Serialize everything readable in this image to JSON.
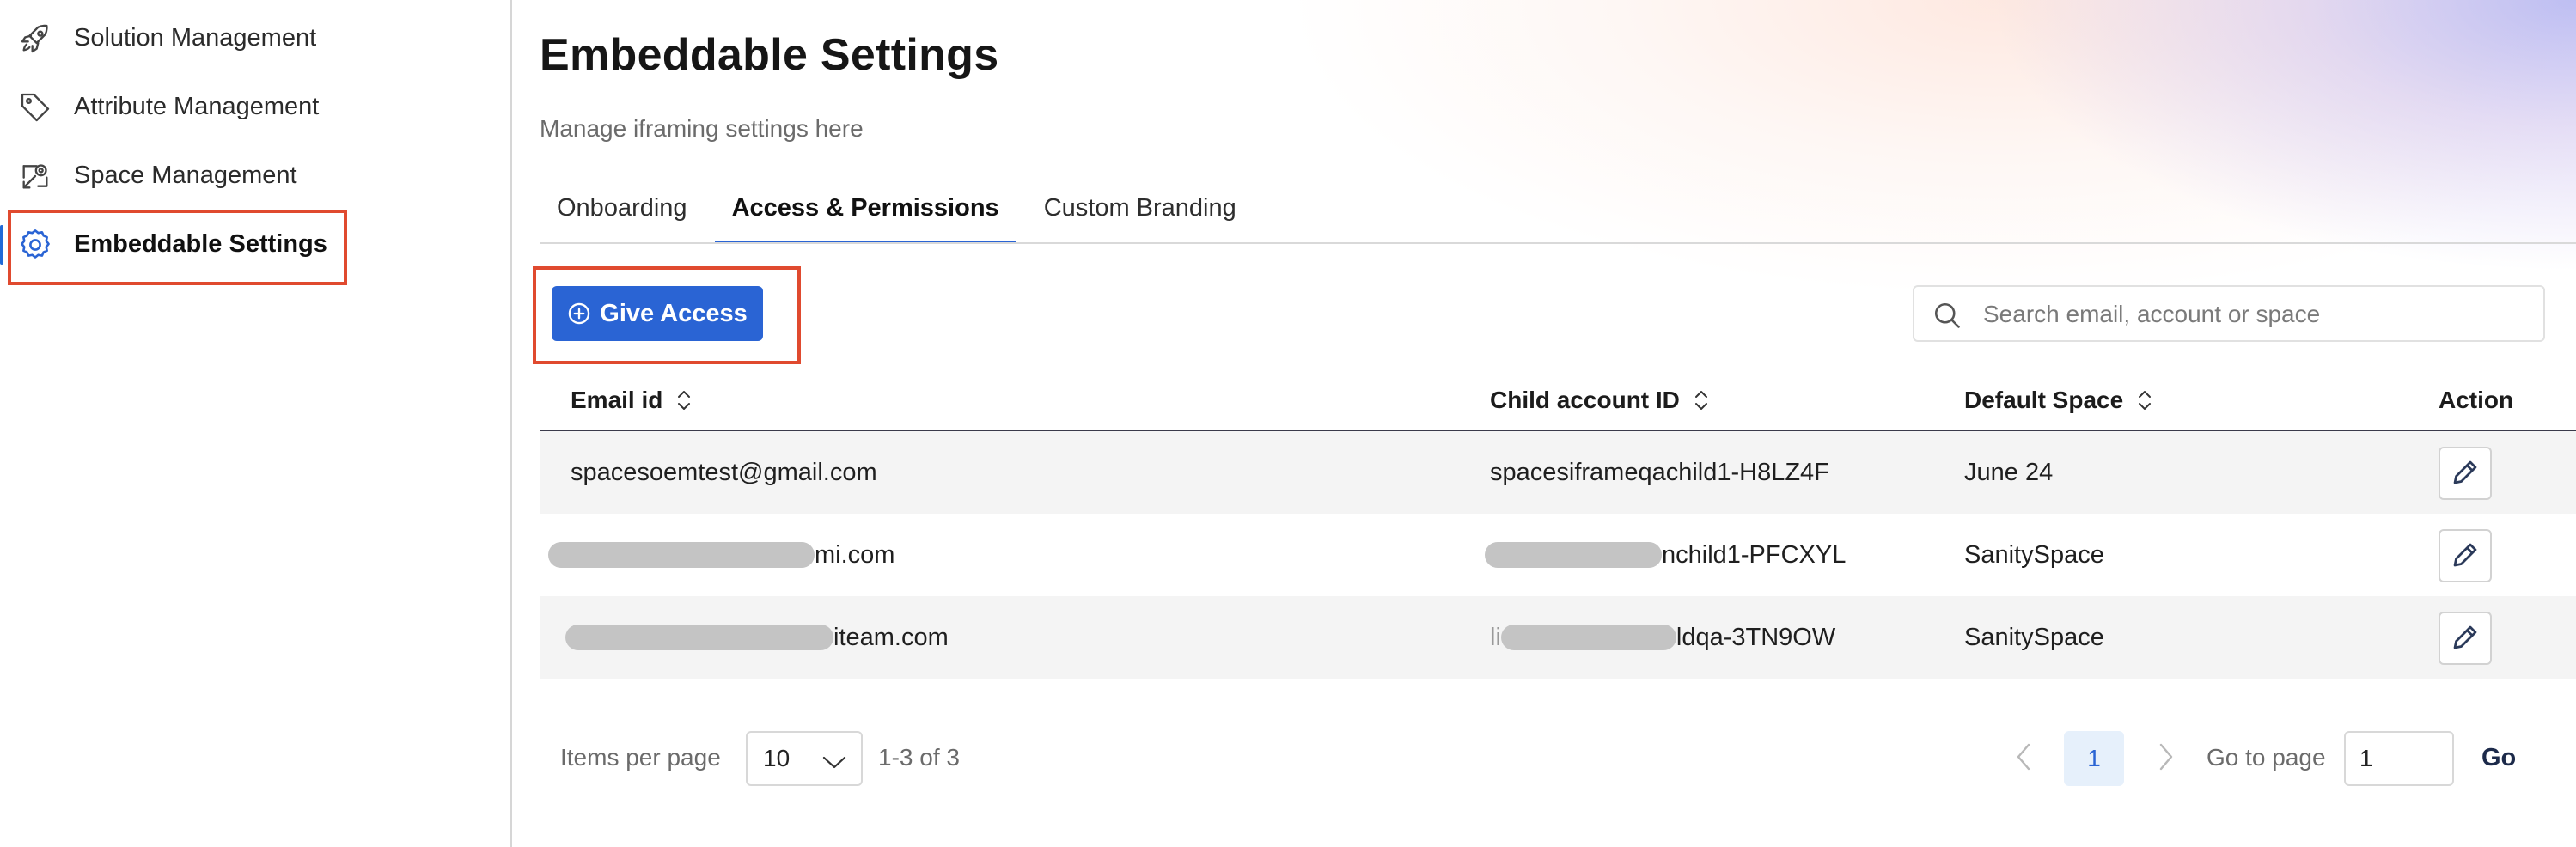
{
  "sidebar": {
    "items": [
      {
        "label": "Solution Management",
        "icon": "rocket-icon"
      },
      {
        "label": "Attribute Management",
        "icon": "tag-icon"
      },
      {
        "label": "Space Management",
        "icon": "space-icon"
      },
      {
        "label": "Embeddable Settings",
        "icon": "gear-icon",
        "active": true
      }
    ]
  },
  "header": {
    "title": "Embeddable Settings",
    "subtitle": "Manage iframing settings here"
  },
  "tabs": [
    {
      "label": "Onboarding"
    },
    {
      "label": "Access & Permissions",
      "active": true
    },
    {
      "label": "Custom Branding"
    }
  ],
  "toolbar": {
    "give_access_label": "Give Access",
    "search_placeholder": "Search email, account or space"
  },
  "table": {
    "columns": [
      "Email id",
      "Child account ID",
      "Default Space",
      "Action"
    ],
    "rows": [
      {
        "email": "spacesoemtest@gmail.com",
        "child_account": "spacesiframeqachild1-H8LZ4F",
        "space": "June 24"
      },
      {
        "email": "mi.com",
        "child_account": "nchild1-PFCXYL",
        "space": "SanitySpace"
      },
      {
        "email": "iteam.com",
        "child_account_prefix": "li",
        "child_account": "ldqa-3TN9OW",
        "space": "SanitySpace"
      }
    ]
  },
  "pagination": {
    "items_per_page_label": "Items per page",
    "items_per_page_value": "10",
    "range": "1-3 of 3",
    "current_page": "1",
    "goto_label": "Go to page",
    "goto_value": "1",
    "go_label": "Go"
  },
  "colors": {
    "accent": "#2a64d4",
    "highlight": "#e04a2f",
    "row_alt": "#f4f4f4"
  }
}
